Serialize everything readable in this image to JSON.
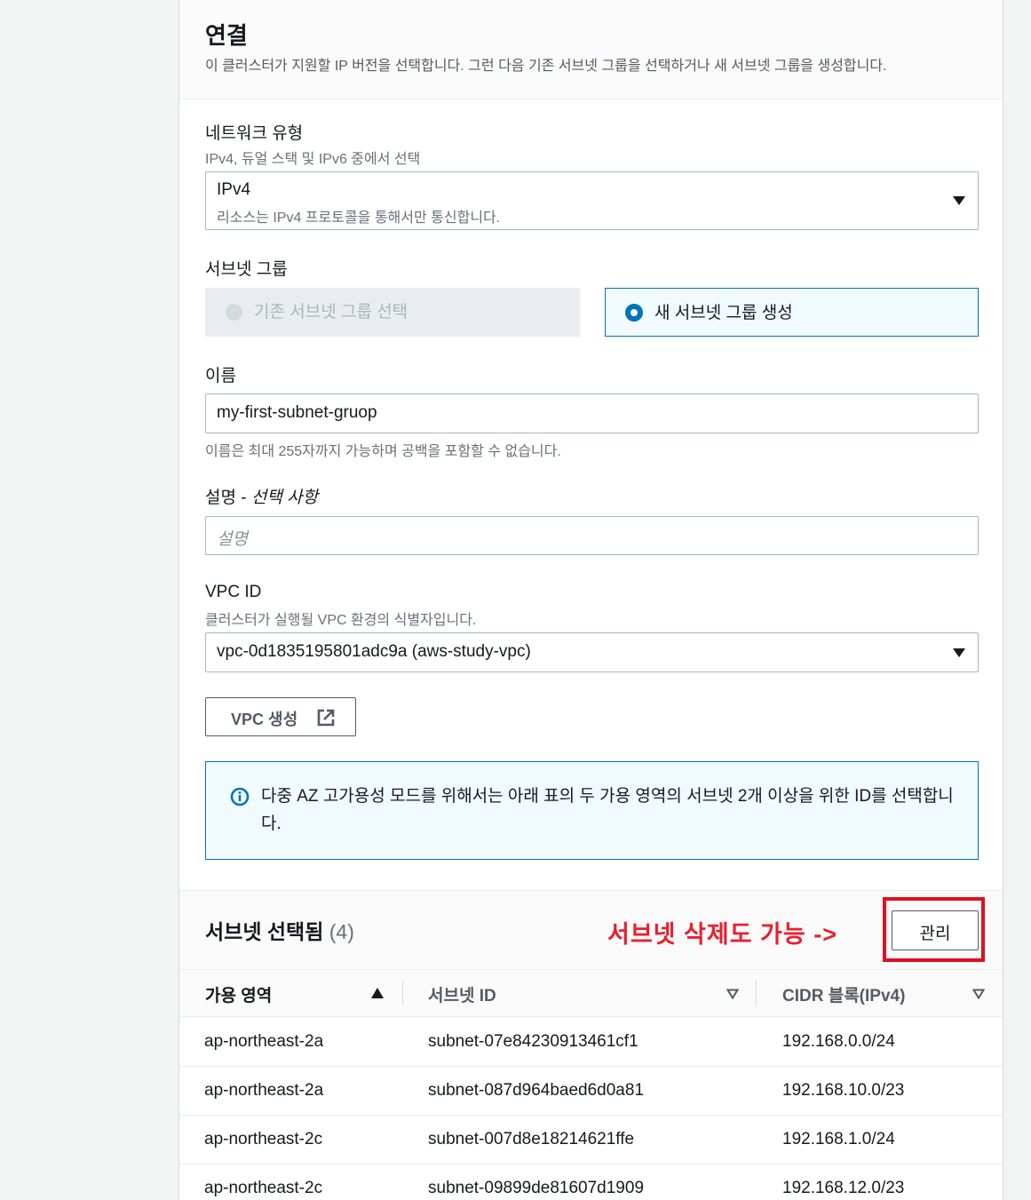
{
  "section": {
    "title": "연결",
    "description": "이 클러스터가 지원할 IP 버전을 선택합니다. 그런 다음 기존 서브넷 그룹을 선택하거나 새 서브넷 그룹을 생성합니다."
  },
  "network_type": {
    "label": "네트워크 유형",
    "description": "IPv4, 듀얼 스택 및 IPv6 중에서 선택",
    "selected_value": "IPv4",
    "selected_description": "리소스는 IPv4 프로토콜을 통해서만 통신합니다."
  },
  "subnet_group": {
    "label": "서브넷 그룹",
    "option_existing": "기존 서브넷 그룹 선택",
    "option_new": "새 서브넷 그룹 생성"
  },
  "name": {
    "label": "이름",
    "value": "my-first-subnet-gruop",
    "constraint": "이름은 최대 255자까지 가능하며 공백을 포함할 수 없습니다."
  },
  "description_field": {
    "label": "설명 - ",
    "label_optional": "선택 사항",
    "placeholder": "설명"
  },
  "vpc": {
    "label": "VPC ID",
    "description": "클러스터가 실행될 VPC 환경의 식별자입니다.",
    "selected_value": "vpc-0d1835195801adc9a (aws-study-vpc)",
    "create_button": "VPC 생성"
  },
  "info_alert": {
    "text": "다중 AZ 고가용성 모드를 위해서는 아래 표의 두 가용 영역의 서브넷 2개 이상을 위한 ID를 선택합니다."
  },
  "subnets_table": {
    "title": "서브넷 선택됨",
    "count": "(4)",
    "manage_button": "관리",
    "annotation": "서브넷 삭제도 가능 ->",
    "columns": [
      "가용 영역",
      "서브넷 ID",
      "CIDR 블록(IPv4)"
    ],
    "rows": [
      {
        "az": "ap-northeast-2a",
        "subnet_id": "subnet-07e84230913461cf1",
        "cidr": "192.168.0.0/24"
      },
      {
        "az": "ap-northeast-2a",
        "subnet_id": "subnet-087d964baed6d0a81",
        "cidr": "192.168.10.0/23"
      },
      {
        "az": "ap-northeast-2c",
        "subnet_id": "subnet-007d8e18214621ffe",
        "cidr": "192.168.1.0/24"
      },
      {
        "az": "ap-northeast-2c",
        "subnet_id": "subnet-09899de81607d1909",
        "cidr": "192.168.12.0/23"
      }
    ]
  },
  "colors": {
    "accent": "#0073bb",
    "annotation_red": "#e8202f"
  }
}
